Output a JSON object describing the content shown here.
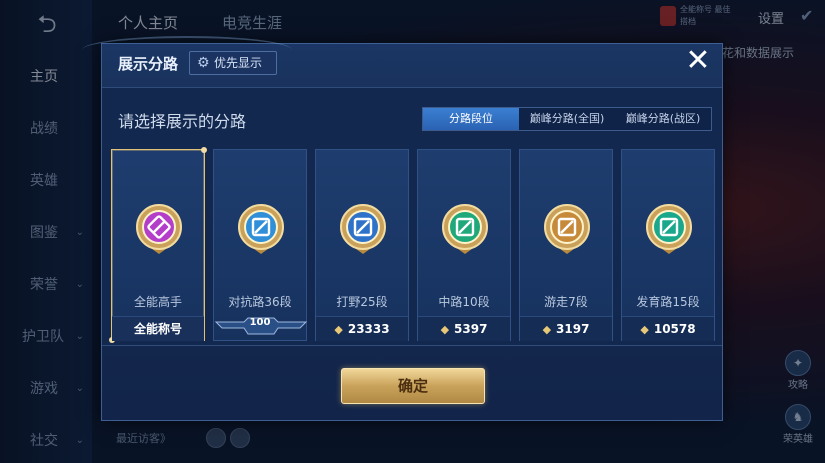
{
  "background": {
    "top_tabs": [
      "个人主页",
      "电竞生涯"
    ],
    "settings_label": "设置",
    "badge_text": "全能称号 最佳搭档",
    "right_text": "花和数据展示",
    "nav_items": [
      {
        "label": "主页",
        "active": true,
        "has_chevron": false
      },
      {
        "label": "战绩",
        "active": false,
        "has_chevron": false
      },
      {
        "label": "英雄",
        "active": false,
        "has_chevron": false
      },
      {
        "label": "图鉴",
        "active": false,
        "has_chevron": true
      },
      {
        "label": "荣誉",
        "active": false,
        "has_chevron": true
      },
      {
        "label": "护卫队",
        "active": false,
        "has_chevron": true
      },
      {
        "label": "游戏",
        "active": false,
        "has_chevron": true
      },
      {
        "label": "社交",
        "active": false,
        "has_chevron": true
      }
    ],
    "recent_visitors": "最近访客》",
    "right_buttons": [
      "攻略",
      "荣英雄"
    ]
  },
  "modal": {
    "title": "展示分路",
    "priority_label": "优先显示",
    "close_glyph": "✕",
    "panel_title": "请选择展示的分路",
    "tabs": [
      {
        "label": "分路段位",
        "active": true
      },
      {
        "label": "巅峰分路(全国)",
        "active": false
      },
      {
        "label": "巅峰分路(战区)",
        "active": false
      }
    ],
    "lanes": [
      {
        "name": "全能高手",
        "footer": "全能称号",
        "score": null,
        "selected": true,
        "color": "#b43ec9",
        "icon": "all-round-emblem"
      },
      {
        "name": "对抗路36段",
        "footer": "",
        "ribbon": "100",
        "score": null,
        "selected": false,
        "color": "#2f8fd8",
        "icon": "clash-lane-emblem"
      },
      {
        "name": "打野25段",
        "footer": "",
        "score": "23333",
        "selected": false,
        "color": "#2f72c9",
        "icon": "jungle-emblem"
      },
      {
        "name": "中路10段",
        "footer": "",
        "score": "5397",
        "selected": false,
        "color": "#1fa97a",
        "icon": "mid-lane-emblem"
      },
      {
        "name": "游走7段",
        "footer": "",
        "score": "3197",
        "selected": false,
        "color": "#c78a3a",
        "icon": "roam-emblem"
      },
      {
        "name": "发育路15段",
        "footer": "",
        "score": "10578",
        "selected": false,
        "color": "#19a88b",
        "icon": "farm-lane-emblem"
      }
    ],
    "confirm_label": "确定"
  }
}
